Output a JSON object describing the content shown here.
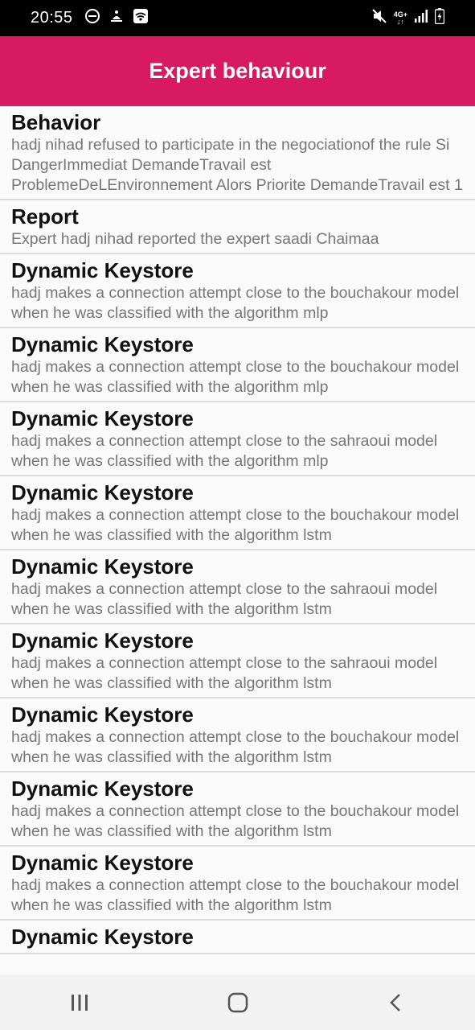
{
  "status_bar": {
    "time": "20:55",
    "network": "4G+",
    "left_icons": [
      "do-not-disturb-icon",
      "notification-icon",
      "wifi-hotspot-icon"
    ],
    "right_icons": [
      "mute-icon",
      "network-4g-icon",
      "signal-icon",
      "battery-charging-icon"
    ]
  },
  "app_bar": {
    "title": "Expert behaviour",
    "color": "#d81b60"
  },
  "list": {
    "items": [
      {
        "title": "Behavior",
        "description": "hadj nihad refused to participate in the negociationof the rule Si DangerImmediat DemandeTravail est ProblemeDeLEnvironnement Alors Priorite DemandeTravail est 1"
      },
      {
        "title": "Report",
        "description": "Expert hadj nihad reported the expert saadi Chaimaa"
      },
      {
        "title": "Dynamic Keystore",
        "description": "hadj makes a connection attempt close to the bouchakour model when he was classified with the algorithm mlp"
      },
      {
        "title": "Dynamic Keystore",
        "description": "hadj makes a connection attempt close to the bouchakour model when he was classified with the algorithm mlp"
      },
      {
        "title": "Dynamic Keystore",
        "description": "hadj makes a connection attempt close to the sahraoui model when he was classified with the algorithm mlp"
      },
      {
        "title": "Dynamic Keystore",
        "description": "hadj makes a connection attempt close to the bouchakour model when he was classified with the algorithm lstm"
      },
      {
        "title": "Dynamic Keystore",
        "description": "hadj makes a connection attempt close to the sahraoui model when he was classified with the algorithm lstm"
      },
      {
        "title": "Dynamic Keystore",
        "description": "hadj makes a connection attempt close to the sahraoui model when he was classified with the algorithm lstm"
      },
      {
        "title": "Dynamic Keystore",
        "description": "hadj makes a connection attempt close to the bouchakour model when he was classified with the algorithm lstm"
      },
      {
        "title": "Dynamic Keystore",
        "description": "hadj makes a connection attempt close to the bouchakour model when he was classified with the algorithm lstm"
      },
      {
        "title": "Dynamic Keystore",
        "description": "hadj makes a connection attempt close to the bouchakour model when he was classified with the algorithm lstm"
      },
      {
        "title": "Dynamic Keystore",
        "description": ""
      }
    ]
  },
  "nav_bar": {
    "buttons": [
      "recent-apps-icon",
      "home-icon",
      "back-icon"
    ]
  }
}
